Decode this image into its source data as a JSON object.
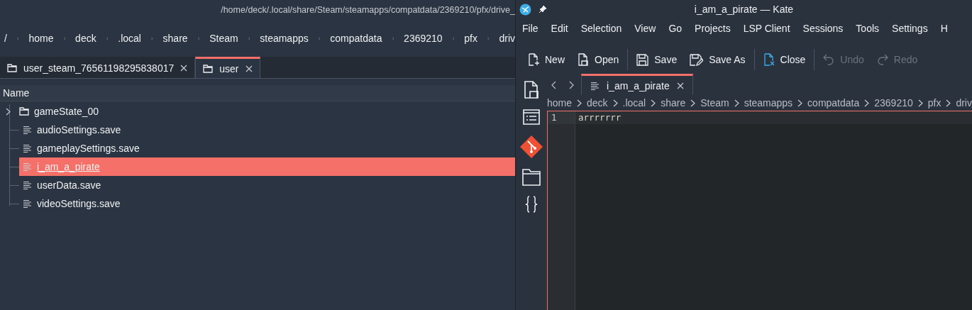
{
  "file_manager": {
    "title": "/home/deck/.local/share/Steam/steamapps/compatdata/2369210/pfx/drive_",
    "breadcrumb": [
      "/",
      "home",
      "deck",
      ".local",
      "share",
      "Steam",
      "steamapps",
      "compatdata",
      "2369210",
      "pfx",
      "driv"
    ],
    "tabs": [
      {
        "label": "user_steam_76561198295838017",
        "selected": false
      },
      {
        "label": "user",
        "selected": true
      }
    ],
    "column_header": "Name",
    "tree": [
      {
        "name": "gameState_00",
        "kind": "folder",
        "expanded": false,
        "selected": false
      },
      {
        "name": "audioSettings.save",
        "kind": "file",
        "selected": false
      },
      {
        "name": "gameplaySettings.save",
        "kind": "file",
        "selected": false
      },
      {
        "name": "i_am_a_pirate",
        "kind": "file",
        "selected": true
      },
      {
        "name": "userData.save",
        "kind": "file",
        "selected": false
      },
      {
        "name": "videoSettings.save",
        "kind": "file",
        "selected": false
      }
    ]
  },
  "kate": {
    "title": "i_am_a_pirate — Kate",
    "menu": [
      "File",
      "Edit",
      "Selection",
      "View",
      "Go",
      "Projects",
      "LSP Client",
      "Sessions",
      "Tools",
      "Settings",
      "H"
    ],
    "toolbar": [
      {
        "label": "New",
        "kind": "new",
        "disabled": false
      },
      {
        "label": "Open",
        "kind": "open",
        "disabled": false
      },
      {
        "label": "Save",
        "kind": "save",
        "disabled": false
      },
      {
        "label": "Save As",
        "kind": "saveas",
        "disabled": false
      },
      {
        "label": "Close",
        "kind": "close",
        "disabled": false
      },
      {
        "label": "Undo",
        "kind": "undo",
        "disabled": true
      },
      {
        "label": "Redo",
        "kind": "redo",
        "disabled": true
      }
    ],
    "tabs": [
      {
        "label": "i_am_a_pirate",
        "selected": true
      }
    ],
    "breadcrumb": [
      "home",
      "deck",
      ".local",
      "share",
      "Steam",
      "steamapps",
      "compatdata",
      "2369210",
      "pfx",
      "driv"
    ],
    "lines": [
      {
        "number": "1",
        "text": "arrrrrrr"
      }
    ]
  }
}
